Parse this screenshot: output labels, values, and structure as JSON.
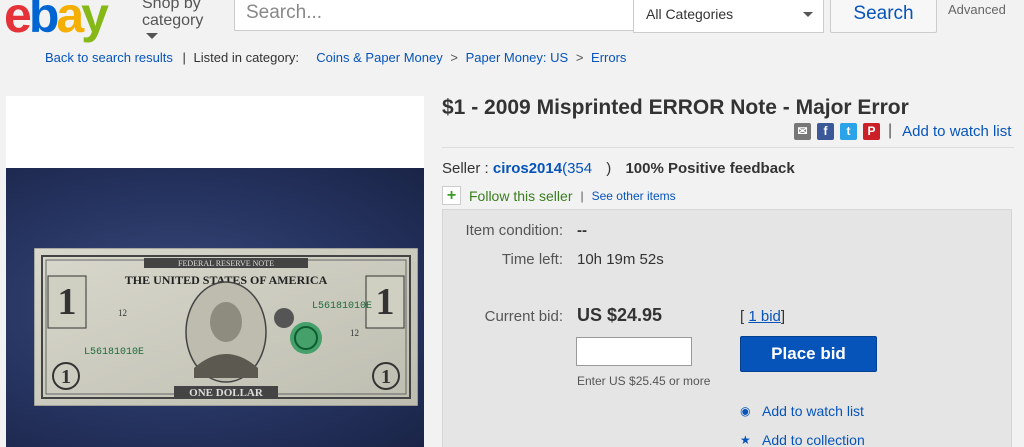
{
  "header": {
    "logo": {
      "e": "e",
      "b": "b",
      "a": "a",
      "y": "y"
    },
    "shop_by": "Shop by category",
    "search_placeholder": "Search...",
    "category_selected": "All Categories",
    "search_button": "Search",
    "advanced": "Advanced"
  },
  "breadcrumb": {
    "back": "Back to search results",
    "pipe": "|",
    "listed_in": "Listed in category:",
    "items": [
      "Coins & Paper Money",
      "Paper Money: US",
      "Errors"
    ],
    "separator": ">"
  },
  "listing": {
    "title": "$1 - 2009 Misprinted ERROR Note - Major Error",
    "share_icons": [
      "mail-icon",
      "facebook-icon",
      "twitter-icon",
      "pinterest-icon"
    ],
    "share_pipe": "|",
    "add_to_watch_list": "Add to watch list",
    "seller_label": "Seller :",
    "seller_name": "ciros2014",
    "seller_score_open": "(",
    "seller_score": "354",
    "seller_score_close": ")",
    "positive_feedback": "100% Positive feedback",
    "follow_plus": "+",
    "follow_seller": "Follow this seller",
    "follow_pipe": "|",
    "see_other_items": "See other items"
  },
  "bid": {
    "condition_label": "Item condition:",
    "condition_value": "--",
    "time_left_label": "Time left:",
    "time_left_value": "10h 19m 52s",
    "current_bid_label": "Current bid:",
    "current_bid_value": "US $24.95",
    "bid_count_open": "[",
    "bid_count": "1 bid",
    "bid_count_close": "]",
    "enter_hint": "Enter US $25.45 or more",
    "place_bid": "Place bid",
    "add_to_watch_list": "Add to watch list",
    "add_to_collection": "Add to collection",
    "watch_icon": "eye-icon",
    "collection_icon": "star-icon"
  },
  "note": {
    "top_banner": "FEDERAL RESERVE NOTE",
    "country": "THE UNITED STATES OF AMERICA",
    "serial_top": "L56181010E",
    "serial_bottom": "L56181010E",
    "denomination": "ONE DOLLAR",
    "number": "1",
    "plate": "12"
  },
  "colors": {
    "link": "#0654ba",
    "bid_button": "#0654ba",
    "follow_green": "#3a9d23",
    "bid_box": "#e5e5e5"
  }
}
